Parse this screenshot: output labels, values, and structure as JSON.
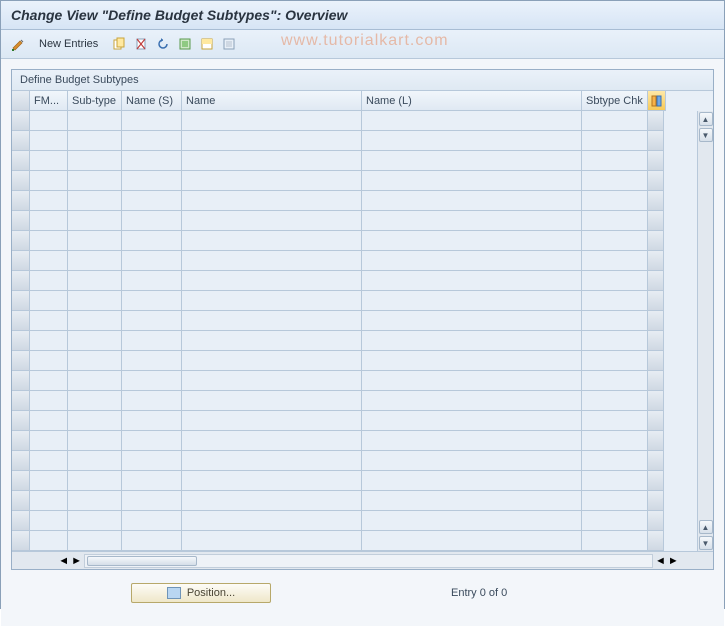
{
  "title": "Change View \"Define Budget Subtypes\": Overview",
  "toolbar": {
    "new_entries_label": "New Entries",
    "icons": [
      {
        "name": "pencil-check-icon"
      },
      {
        "name": "copy-icon"
      },
      {
        "name": "variant-icon"
      },
      {
        "name": "undo-icon"
      },
      {
        "name": "select-all-icon"
      },
      {
        "name": "select-block-icon"
      },
      {
        "name": "deselect-all-icon"
      }
    ]
  },
  "watermark": "www.tutorialkart.com",
  "grid": {
    "title": "Define Budget Subtypes",
    "columns": [
      {
        "key": "fm",
        "label": "FM..."
      },
      {
        "key": "sub",
        "label": "Sub-type"
      },
      {
        "key": "ns",
        "label": "Name (S)"
      },
      {
        "key": "n",
        "label": "Name"
      },
      {
        "key": "nl",
        "label": "Name (L)"
      },
      {
        "key": "chk",
        "label": "Sbtype Chk"
      }
    ],
    "rows": []
  },
  "footer": {
    "position_label": "Position...",
    "entry_status": "Entry 0 of 0"
  }
}
